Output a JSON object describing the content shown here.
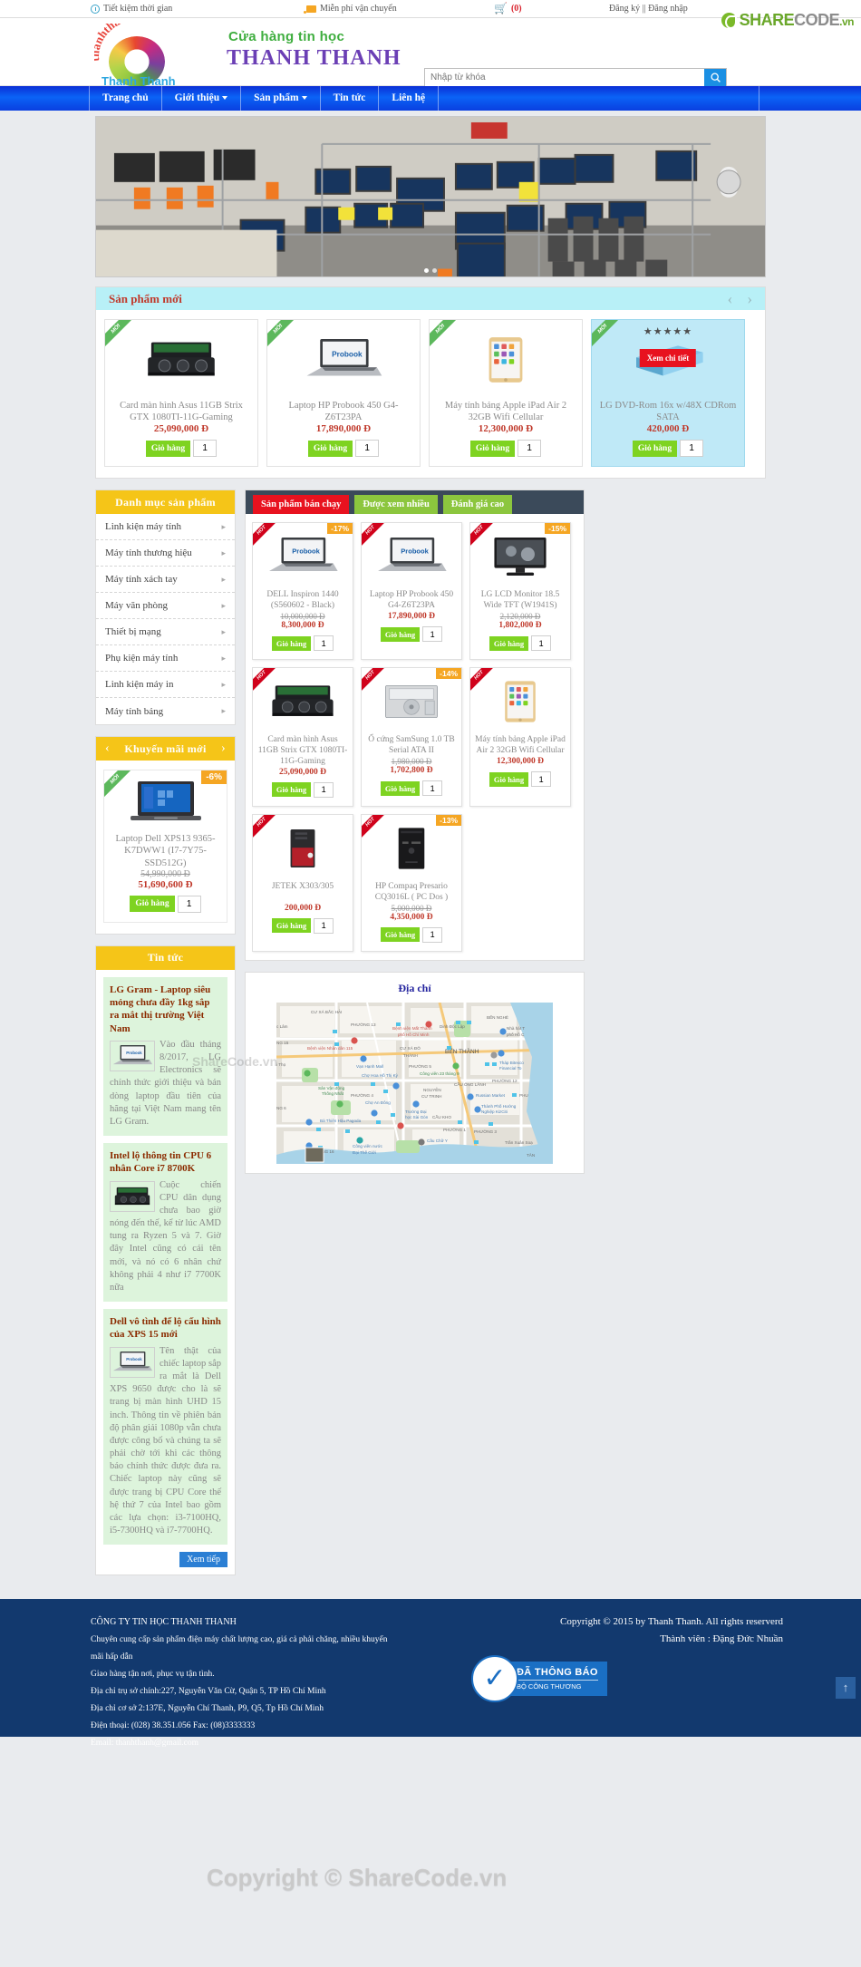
{
  "topbar": {
    "saving": "Tiết kiệm thời gian",
    "shipping": "Miễn phí vận chuyển",
    "cart_count": "(0)",
    "account": "Đăng ký || Đăng nhập"
  },
  "brandmark": {
    "a": "SHARE",
    "b": "CODE",
    "c": ".vn"
  },
  "header": {
    "logo_text": "thanhthanh.vn",
    "logo_name": "Thanh Thanh",
    "shop_sub": "Cửa hàng tin học",
    "shop_title": "THANH THANH",
    "search_placeholder": "Nhập từ khóa"
  },
  "nav": [
    {
      "label": "Trang chủ",
      "caret": false
    },
    {
      "label": "Giới thiệu",
      "caret": true
    },
    {
      "label": "Sản phẩm",
      "caret": true
    },
    {
      "label": "Tin tức",
      "caret": false
    },
    {
      "label": "Liên hệ",
      "caret": false
    }
  ],
  "new_products": {
    "title": "Sản phẩm mới",
    "prev": "‹",
    "next": "›",
    "badge": "MỚI",
    "cart_label": "Giỏ hàng",
    "qty": "1",
    "detail_label": "Xem chi tiết",
    "items": [
      {
        "name": "Card màn hình Asus 11GB Strix GTX 1080TI-11G-Gaming",
        "price": "25,090,000 Đ",
        "old": ""
      },
      {
        "name": "Laptop HP Probook 450 G4-Z6T23PA",
        "price": "17,890,000 Đ",
        "old": ""
      },
      {
        "name": "Máy tính bảng Apple iPad Air 2 32GB Wifi Cellular",
        "price": "12,300,000 Đ",
        "old": ""
      },
      {
        "name": "LG DVD-Rom 16x w/48X CDRom SATA",
        "price": "420,000 Đ",
        "old": ""
      }
    ]
  },
  "sidebar": {
    "categories_title": "Danh mục sản phẩm",
    "categories": [
      "Linh kiện máy tính",
      "Máy tính thương hiệu",
      "Máy tính xách tay",
      "Máy văn phòng",
      "Thiết bị mạng",
      "Phụ kiện máy tính",
      "Linh kiện máy in",
      "Máy tính bảng"
    ],
    "promo_title": "Khuyến mãi mới",
    "promo_prev": "‹",
    "promo_next": "›",
    "promo": {
      "badge": "MỚI",
      "discount": "-6%",
      "name": "Laptop Dell XPS13 9365-K7DWW1 (I7-7Y75-SSD512G)",
      "old": "54,990,000 Đ",
      "price": "51,690,600 Đ",
      "cart_label": "Giỏ hàng",
      "qty": "1"
    },
    "news_title": "Tin tức",
    "news": [
      {
        "title": "LG Gram - Laptop siêu mỏng chưa đầy 1kg sắp ra mắt thị trường Việt Nam",
        "body": "Vào đầu tháng 8/2017, LG Electronics sẽ chính thức giới thiệu và bán dòng laptop đầu tiên của hãng tại Việt Nam mang tên LG Gram."
      },
      {
        "title": "Intel lộ thông tin CPU 6 nhân Core i7 8700K",
        "body": "Cuộc chiến CPU dân dụng chưa bao giờ nóng đến thế, kể từ lúc AMD tung ra Ryzen 5 và 7. Giờ đây Intel cũng có cái tên mới, và nó có 6 nhân chứ không phải 4 như i7 7700K nữa"
      },
      {
        "title": "Dell vô tình để lộ cấu hình của XPS 15 mới",
        "body": "Tên thật của chiếc laptop sắp ra mắt là Dell XPS 9650 được cho là sẽ trang bị màn hình UHD 15 inch. Thông tin về phiên bản độ phân giải 1080p vẫn chưa được công bố và chúng ta sẽ phải chờ tới khi các thông báo chính thức được đưa ra. Chiếc laptop này cũng sẽ được trang bị CPU Core thế hệ thứ 7 của Intel bao gồm các lựa chọn: i3-7100HQ, i5-7300HQ và i7-7700HQ."
      }
    ],
    "news_more": "Xem tiếp"
  },
  "tabs": {
    "items": [
      {
        "label": "Sản phẩm bán chạy",
        "active": true
      },
      {
        "label": "Được xem nhiều",
        "active": false
      },
      {
        "label": "Đánh giá cao",
        "active": false
      }
    ],
    "badge": "HOT",
    "cart_label": "Giỏ hàng",
    "qty": "1",
    "products": [
      {
        "name": "DELL Inspiron 1440 (S560602 - Black)",
        "old": "10,000,000 Đ",
        "price": "8,300,000 Đ",
        "discount": "-17%"
      },
      {
        "name": "Laptop HP Probook 450 G4-Z6T23PA",
        "old": "",
        "price": "17,890,000 Đ",
        "discount": ""
      },
      {
        "name": "LG LCD Monitor 18.5 Wide TFT (W1941S)",
        "old": "2,120,000 Đ",
        "price": "1,802,000 Đ",
        "discount": "-15%"
      },
      {
        "name": "Card màn hình Asus 11GB Strix GTX 1080TI-11G-Gaming",
        "old": "",
        "price": "25,090,000 Đ",
        "discount": ""
      },
      {
        "name": "Ổ cứng SamSung 1.0 TB Serial ATA II",
        "old": "1,980,000 Đ",
        "price": "1,702,800 Đ",
        "discount": "-14%"
      },
      {
        "name": "Máy tính bảng Apple iPad Air 2 32GB Wifi Cellular",
        "old": "",
        "price": "12,300,000 Đ",
        "discount": ""
      },
      {
        "name": "JETEK X303/305",
        "old": "",
        "price": "200,000 Đ",
        "discount": ""
      },
      {
        "name": "HP Compaq Presario CQ3016L ( PC Dos )",
        "old": "5,000,000 Đ",
        "price": "4,350,000 Đ",
        "discount": "-13%"
      }
    ]
  },
  "map": {
    "title": "Địa chỉ",
    "labels": [
      "CƯ XÁ BẮC HẢI",
      "PHƯỜNG 13",
      "BẾN NGHÉ",
      "Bệnh viện Mắt Thành phố Hồ Chí Minh",
      "Dinh Độc Lập",
      "Nhà hát Tp phố Hồ C",
      "Bệnh viện Nhân dân 115",
      "CƯ XÁ ĐÔ THÀNH",
      "BẾN THÀNH",
      "Vạn Hạnh Mall",
      "PHƯỜNG 5",
      "Tháp Bitexco Financial To",
      "Chợ Hoa Hồ Thị Kỳ",
      "Công viên 23 tháng 9",
      "PHƯỜNG 12",
      "CẦU ÔNG LÃNH",
      "Sân Vận động Thống Nhất",
      "PHƯỜNG 4",
      "NGUYỄN CƯ TRINH",
      "Russian Market",
      "Chợ An Đông",
      "Trường Đại học Sài Gòn",
      "Thành Phố Hướng Nghiệp KizCiti",
      "Bà Thiên Hậu Pagoda",
      "CẦU KHO",
      "PHƯỜNG 1",
      "PHƯỜNG 3",
      "Công viên nước Đại Thế Giới",
      "Cầu Chữ Y",
      "Trần Xuân Soạn",
      "PHƯỜNG 16"
    ]
  },
  "footer": {
    "company": "CÔNG TY TIN HỌC THANH THANH",
    "line1": "Chuyên cung cấp sản phẩm điện máy chất lượng cao, giá cả phải chăng, nhiều khuyến",
    "line2": "mãi hấp dẫn",
    "line3": "Giao hàng tận nơi, phục vụ tận tình.",
    "line4": "Địa chỉ trụ sở chính:227, Nguyễn Văn Cừ, Quận 5, TP Hồ Chí Minh",
    "line5": "Địa chỉ cơ sở 2:137E, Nguyễn Chí Thanh, P9, Q5, Tp Hồ Chí Minh",
    "line6": "Điện thoại: (028) 38.351.056 Fax: (08)3333333",
    "line7": "Email: thanhthanh@gmail.com",
    "copyright": "Copyright © 2015 by Thanh Thanh. All rights reserverd",
    "member": "Thành viên : Đặng Đức Nhuần",
    "badge_line1": "ĐÃ THÔNG BÁO",
    "badge_line2": "BỘ CÔNG THƯƠNG",
    "gototop": "↑"
  },
  "watermarks": {
    "small": "ShareCode.vn",
    "big": "Copyright © ShareCode.vn"
  }
}
